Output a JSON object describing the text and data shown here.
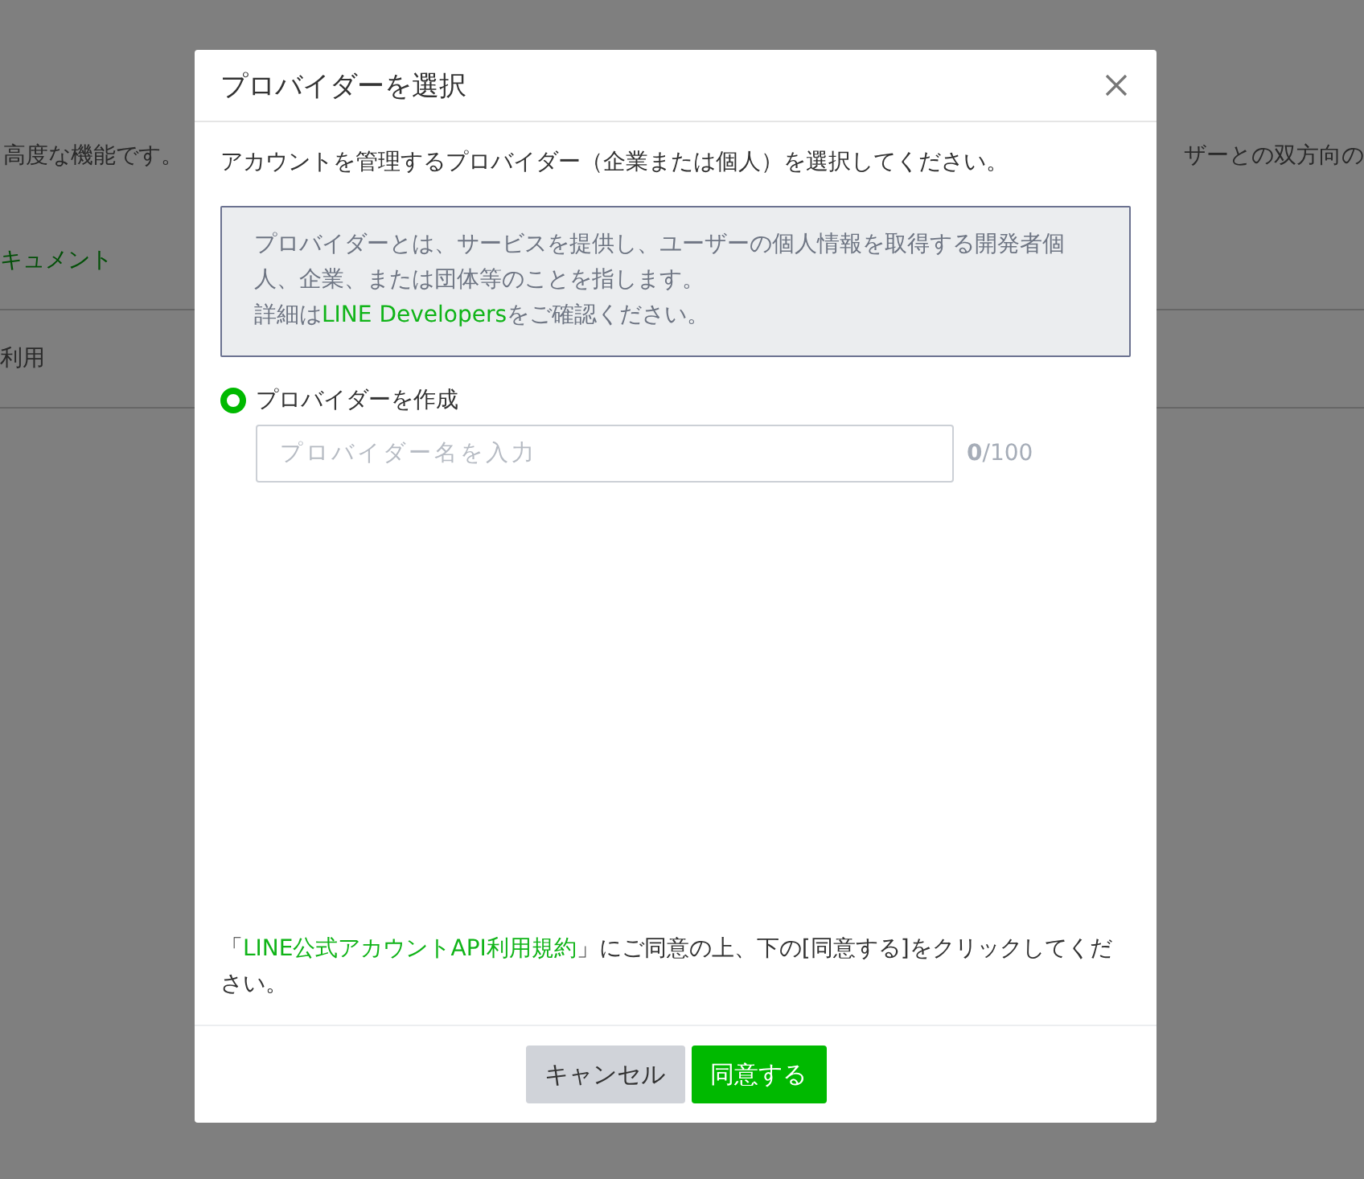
{
  "background": {
    "left_texts": [
      {
        "text": "高度な機能です。",
        "kind": "plain"
      },
      {
        "text": "キュメント",
        "kind": "link"
      },
      {
        "text": "利用",
        "kind": "plain"
      }
    ],
    "right_text": "ザーとの双方向の"
  },
  "dialog": {
    "title": "プロバイダーを選択",
    "instruction": "アカウントを管理するプロバイダー（企業または個人）を選択してください。",
    "info": {
      "description": "プロバイダーとは、サービスを提供し、ユーザーの個人情報を取得する開発者個人、企業、または団体等のことを指します。",
      "detail_prefix": "詳細は",
      "link": "LINE Developers",
      "detail_suffix": "をご確認ください。"
    },
    "option": {
      "label": "プロバイダーを作成",
      "selected": true
    },
    "name_field": {
      "placeholder": "プロバイダー名を入力",
      "count": "0",
      "max": "/100"
    },
    "terms": {
      "open": "「",
      "link": "LINE公式アカウントAPI利用規約",
      "rest": "」にご同意の上、下の[同意する]をクリックしてください。"
    },
    "buttons": [
      {
        "label": "キャンセル",
        "kind": "secondary"
      },
      {
        "label": "同意する",
        "kind": "primary"
      }
    ]
  }
}
